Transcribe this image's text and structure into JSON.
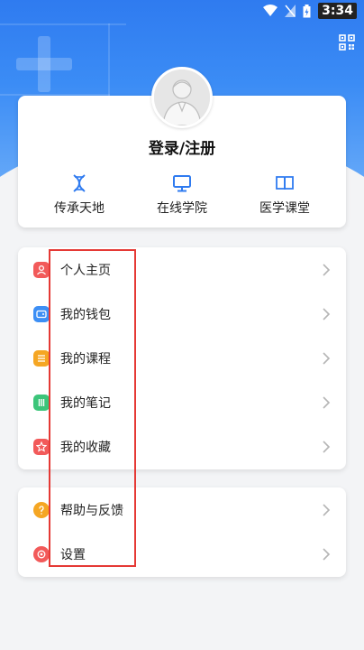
{
  "status_bar": {
    "time": "3:34"
  },
  "profile": {
    "login_label": "登录/注册"
  },
  "quick_links": [
    {
      "label": "传承天地",
      "icon": "dna-icon"
    },
    {
      "label": "在线学院",
      "icon": "monitor-icon"
    },
    {
      "label": "医学课堂",
      "icon": "book-icon"
    }
  ],
  "menu_group1": [
    {
      "label": "个人主页",
      "icon": "user-icon",
      "color": "#f25a5a"
    },
    {
      "label": "我的钱包",
      "icon": "wallet-icon",
      "color": "#3d8ff5"
    },
    {
      "label": "我的课程",
      "icon": "course-icon",
      "color": "#f5a623"
    },
    {
      "label": "我的笔记",
      "icon": "notes-icon",
      "color": "#3cc57a"
    },
    {
      "label": "我的收藏",
      "icon": "star-icon",
      "color": "#f25a5a"
    }
  ],
  "menu_group2": [
    {
      "label": "帮助与反馈",
      "icon": "help-icon",
      "color": "#f5a623"
    },
    {
      "label": "设置",
      "icon": "settings-icon",
      "color": "#f25a5a"
    }
  ],
  "colors": {
    "accent": "#2f7bf0",
    "highlight": "#e53935"
  }
}
